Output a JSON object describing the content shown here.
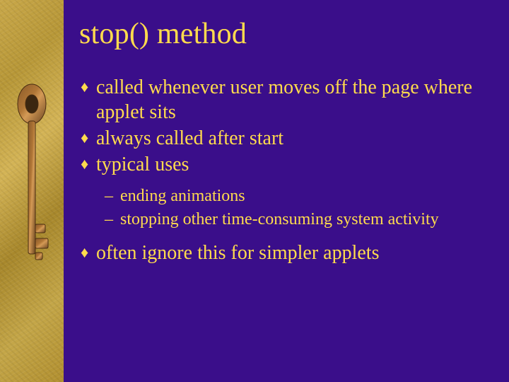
{
  "slide": {
    "title": "stop() method",
    "bullets": {
      "b0": "called whenever user moves off the page where applet sits",
      "b1": "always called after start",
      "b2": "typical uses",
      "b3": "often ignore this for simpler applets"
    },
    "sub": {
      "s0": "ending animations",
      "s1": "stopping other time-consuming system activity"
    },
    "marker": "♦",
    "dash": "–"
  }
}
